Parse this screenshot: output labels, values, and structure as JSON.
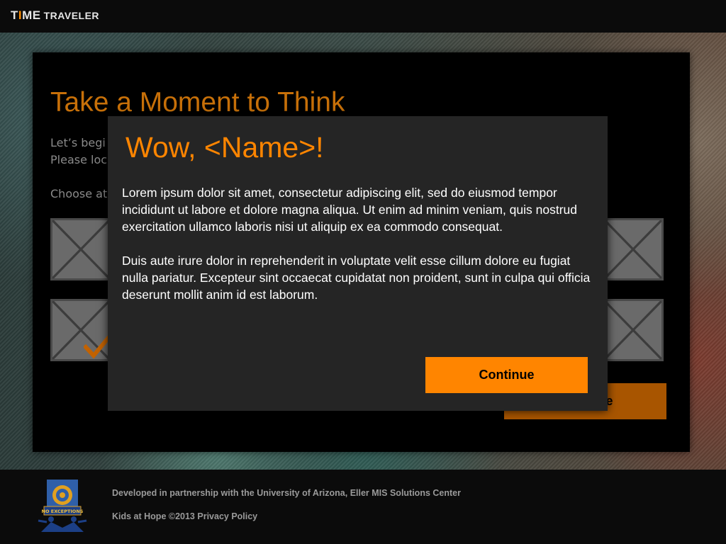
{
  "header": {
    "brand_t": "T",
    "brand_i": "I",
    "brand_me": "ME",
    "brand_sub": "TRAVELER"
  },
  "page": {
    "title": "Take a Moment to Think",
    "intro_line_1": "Let’s begi",
    "intro_line_2": "Please loc",
    "choose_text": "Choose at",
    "continue_label": "Continue",
    "thumbnails": [
      {
        "name": "image-placeholder-1"
      },
      {
        "name": "image-placeholder-2",
        "selected": true
      },
      {
        "name": "image-placeholder-3"
      },
      {
        "name": "image-placeholder-4"
      }
    ]
  },
  "modal": {
    "title": "Wow, <Name>!",
    "paragraph_1": "Lorem ipsum dolor sit amet, consectetur adipiscing elit, sed do eiusmod tempor incididunt ut labore et dolore magna aliqua. Ut enim ad minim veniam, quis nostrud exercitation ullamco laboris nisi ut aliquip ex ea commodo consequat.",
    "paragraph_2": "Duis aute irure dolor in reprehenderit in voluptate velit esse cillum dolore eu fugiat nulla pariatur. Excepteur sint occaecat cupidatat non proident, sunt in culpa qui officia deserunt mollit anim id est laborum.",
    "continue_label": "Continue"
  },
  "footer": {
    "partnership": "Developed in partnership with the University of Arizona, Eller MIS Solutions Center",
    "copyright": "Kids at Hope ©2013 Privacy Policy",
    "logo_text": "NO EXCEPTIONS"
  },
  "colors": {
    "accent": "#ff8500",
    "accent_dim": "#c77009",
    "modal_bg": "#252525",
    "placeholder_gray": "#6a6a6a"
  }
}
